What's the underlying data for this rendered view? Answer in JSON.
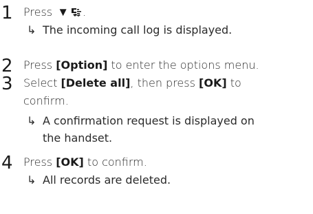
{
  "steps": [
    {
      "number": "1",
      "parts": {
        "pre": "Press ",
        "icon_down": "▼",
        "icon_calllog": "call-log-icon",
        "post": "."
      },
      "result": "The incoming call log is displayed."
    },
    {
      "number": "2",
      "parts": {
        "pre": "Press ",
        "key": "[Option]",
        "post": " to enter the options menu."
      }
    },
    {
      "number": "3",
      "parts": {
        "pre": "Select ",
        "key1": "[Delete all]",
        "mid": ", then press ",
        "key2": "[OK]",
        "post1": " to",
        "post2": "confirm."
      },
      "result_line1": "A confirmation request is displayed on",
      "result_line2": "the handset."
    },
    {
      "number": "4",
      "parts": {
        "pre": "Press ",
        "key": "[OK]",
        "post": " to confirm."
      },
      "result": "All records are deleted."
    }
  ],
  "result_arrow": "↳"
}
